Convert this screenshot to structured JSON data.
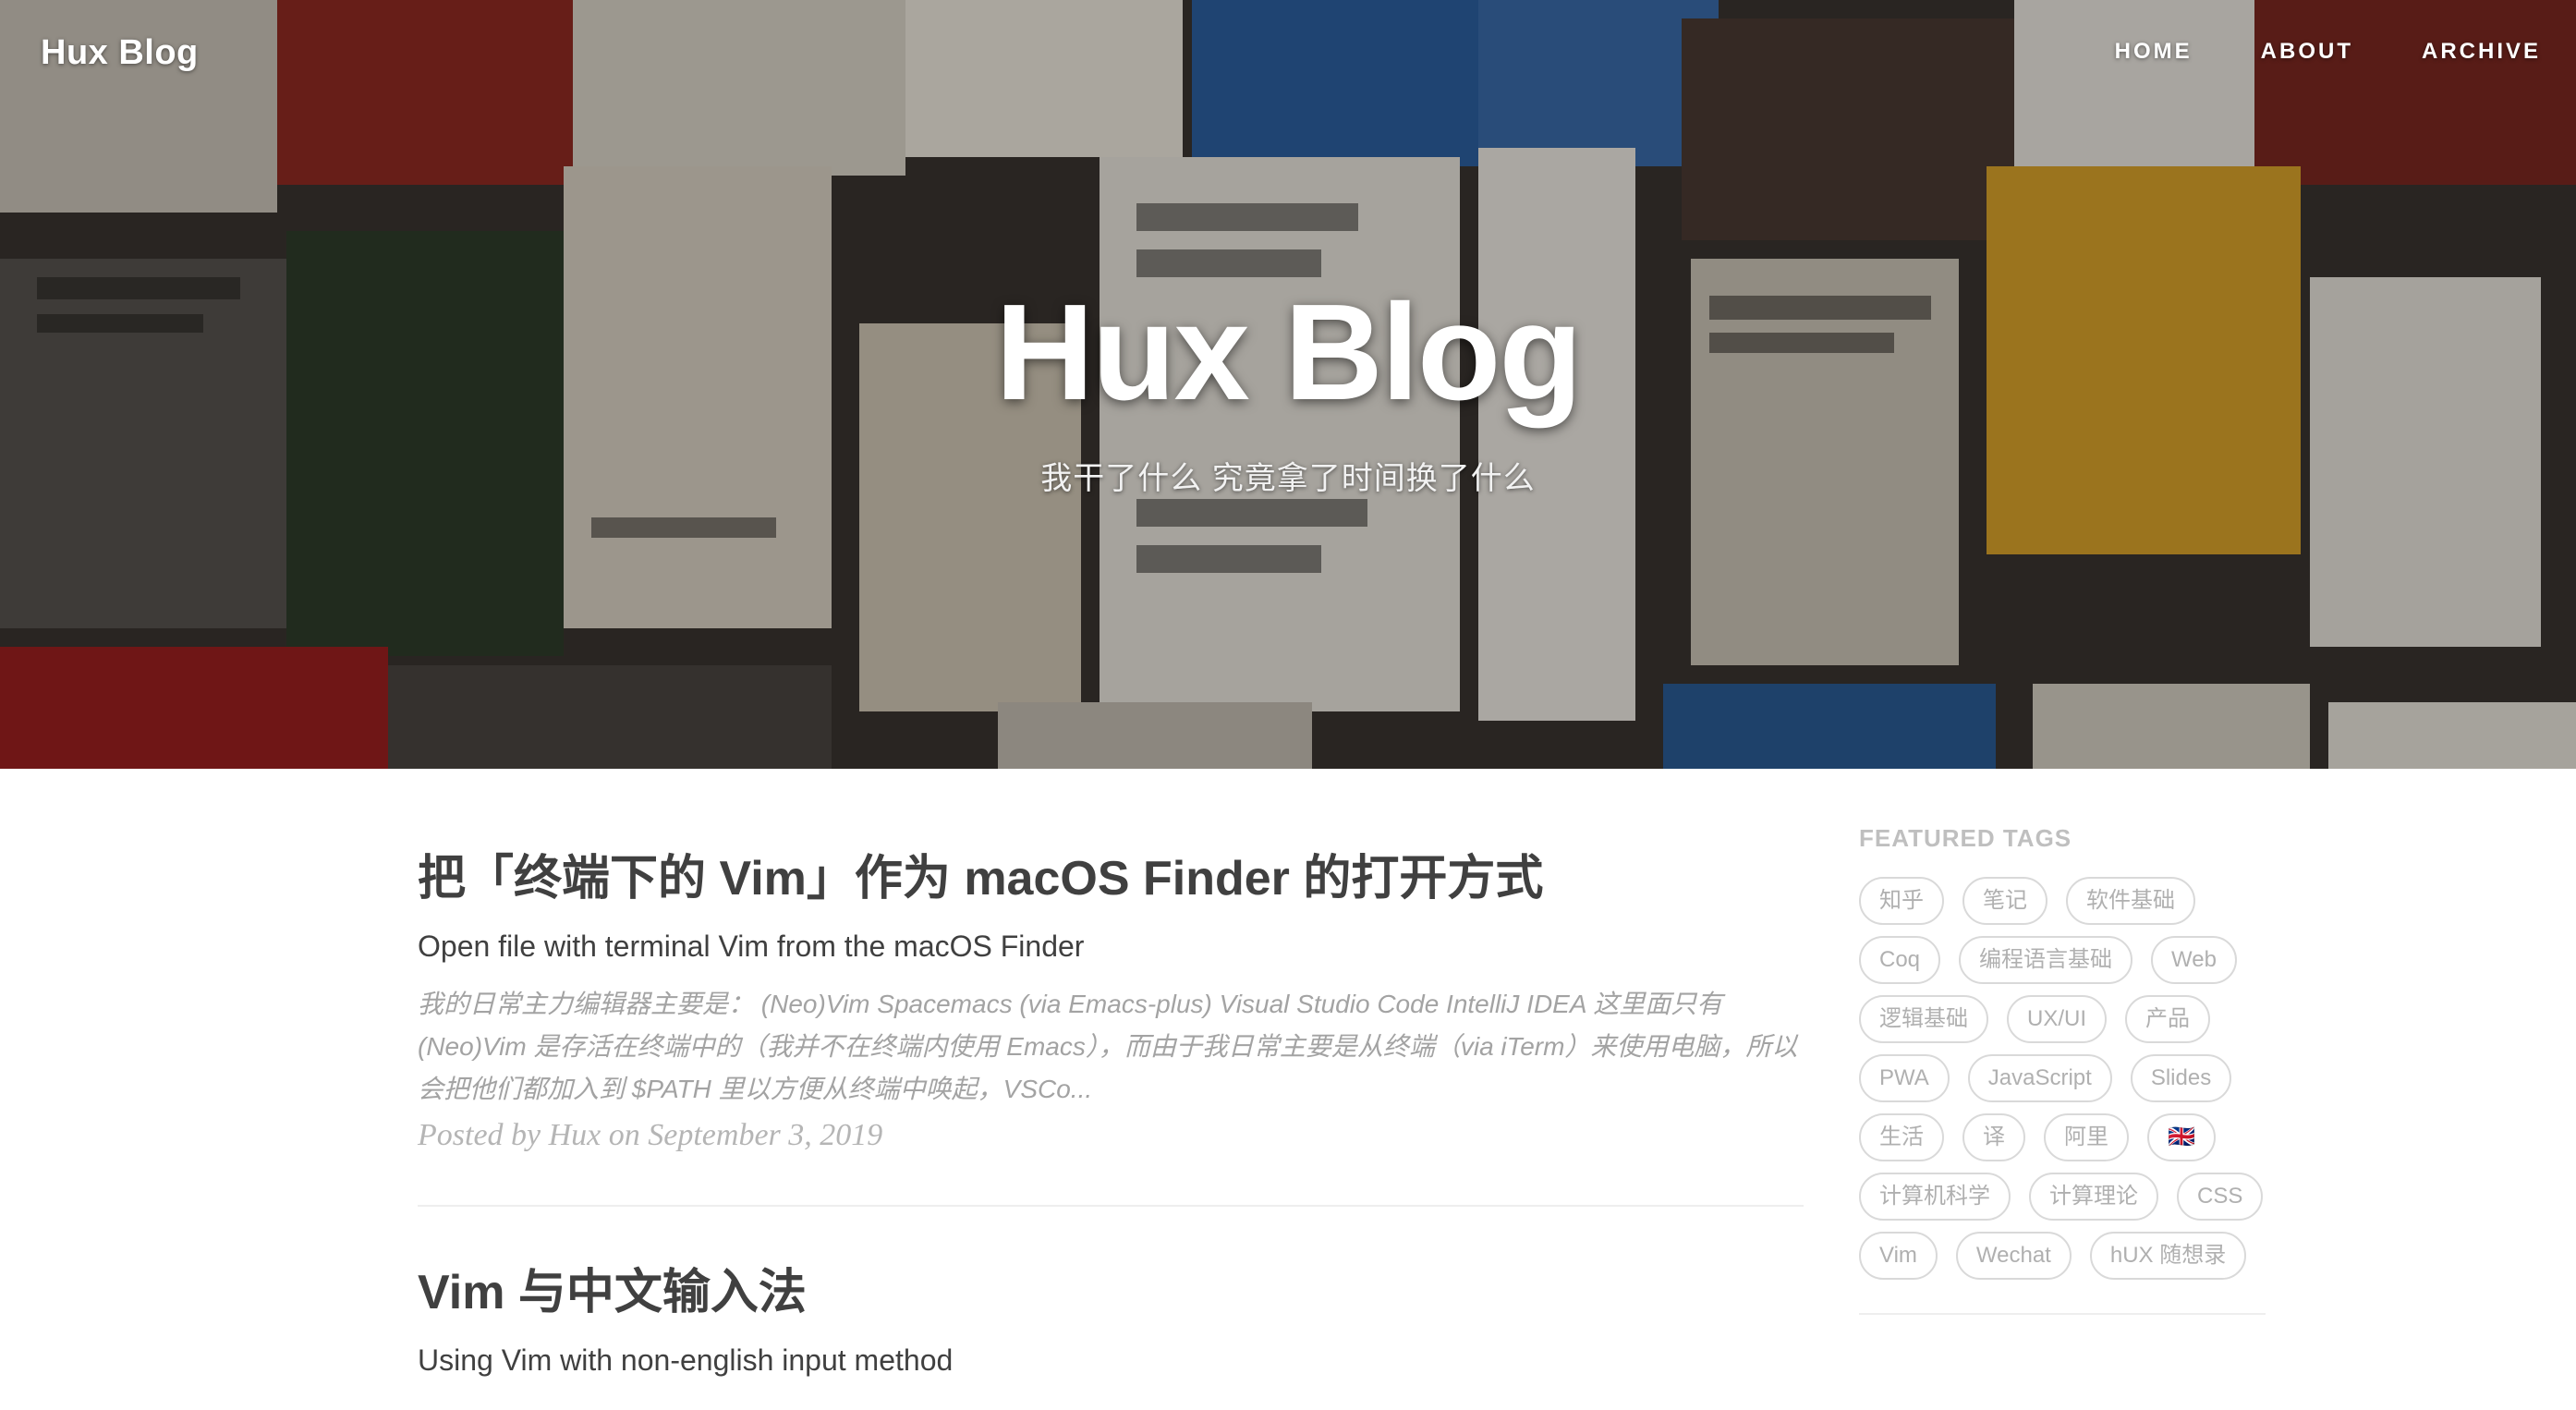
{
  "header": {
    "brand": "Hux Blog",
    "nav": [
      "HOME",
      "ABOUT",
      "ARCHIVE"
    ],
    "title": "Hux Blog",
    "subtitle": "我干了什么 究竟拿了时间换了什么"
  },
  "posts": [
    {
      "title": "把「终端下的 Vim」作为 macOS Finder 的打开方式",
      "subtitle": "Open file with terminal Vim from the macOS Finder",
      "excerpt": "我的日常主力编辑器主要是： (Neo)Vim Spacemacs (via Emacs-plus) Visual Studio Code IntelliJ IDEA 这里面只有 (Neo)Vim 是存活在终端中的（我并不在终端内使用 Emacs），而由于我日常主要是从终端（via iTerm）来使用电脑，所以会把他们都加入到 $PATH 里以方便从终端中唤起，VSCo...",
      "meta": "Posted by Hux on September 3, 2019"
    },
    {
      "title": "Vim 与中文输入法",
      "subtitle": "Using Vim with non-english input method"
    }
  ],
  "sidebar": {
    "heading": "FEATURED TAGS",
    "tags": [
      "知乎",
      "笔记",
      "软件基础",
      "Coq",
      "编程语言基础",
      "Web",
      "逻辑基础",
      "UX/UI",
      "产品",
      "PWA",
      "JavaScript",
      "Slides",
      "生活",
      "译",
      "阿里",
      "🇬🇧",
      "计算机科学",
      "计算理论",
      "CSS",
      "Vim",
      "Wechat",
      "hUX 随想录"
    ]
  },
  "colors": {
    "text_dark": "#404040",
    "text_muted": "#a3a3a3",
    "tag_border": "#d9d9d9",
    "hero_overlay": "rgba(0,0,0,0.28)"
  }
}
